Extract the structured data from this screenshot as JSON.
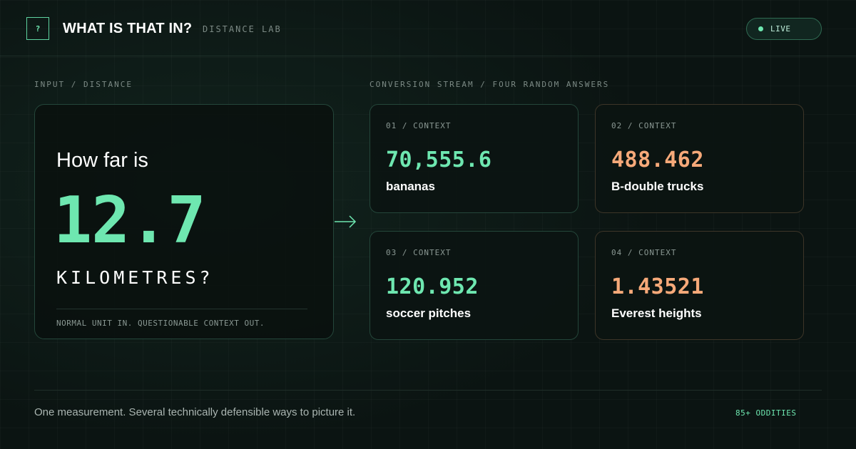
{
  "header": {
    "logo_glyph": "?",
    "title": "WHAT IS THAT IN?",
    "subtitle": "DISTANCE LAB",
    "status_label": "LIVE"
  },
  "input": {
    "section_label": "INPUT / DISTANCE",
    "question": "How far is",
    "value": "12.7",
    "unit": "KILOMETRES?",
    "tagline": "NORMAL UNIT IN. QUESTIONABLE CONTEXT OUT."
  },
  "stream": {
    "section_label": "CONVERSION STREAM / FOUR RANDOM ANSWERS",
    "cards": [
      {
        "label": "01 / CONTEXT",
        "value": "70,555.6",
        "name": "bananas",
        "accent": "green"
      },
      {
        "label": "02 / CONTEXT",
        "value": "488.462",
        "name": "B-double trucks",
        "accent": "orange"
      },
      {
        "label": "03 / CONTEXT",
        "value": "120.952",
        "name": "soccer pitches",
        "accent": "green"
      },
      {
        "label": "04 / CONTEXT",
        "value": "1.43521",
        "name": "Everest heights",
        "accent": "orange"
      }
    ]
  },
  "footer": {
    "text": "One measurement. Several technically defensible ways to picture it.",
    "count": "85+ ODDITIES"
  },
  "colors": {
    "background": "#0b1412",
    "accent_green": "#6ee7b0",
    "accent_orange": "#f6a979"
  },
  "icons": {
    "logo": "question-mark-icon",
    "status": "live-dot-icon",
    "flow": "arrow-right-icon"
  }
}
